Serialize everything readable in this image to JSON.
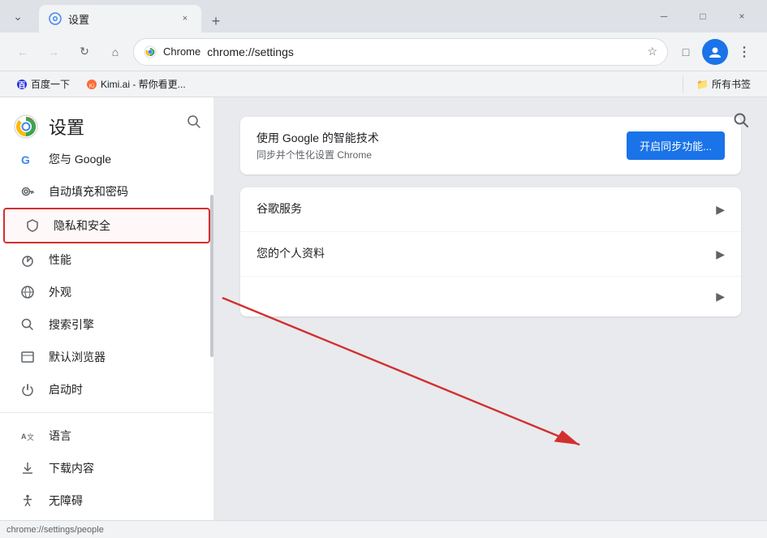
{
  "browser": {
    "tab": {
      "favicon": "⚙",
      "title": "设置",
      "close_label": "×"
    },
    "new_tab_label": "+",
    "window_controls": {
      "minimize": "─",
      "maximize": "□",
      "close": "×"
    },
    "toolbar": {
      "back_label": "←",
      "forward_label": "→",
      "reload_label": "↻",
      "home_label": "⌂",
      "address": "chrome://settings",
      "chrome_label": "Chrome",
      "bookmark_label": "☆",
      "extensions_label": "□",
      "profile_label": "👤",
      "menu_label": "⋮"
    },
    "bookmarks": {
      "item1": "百度一下",
      "item2": "Kimi.ai - 帮你看更...",
      "all_bookmarks": "所有书签"
    },
    "status_bar": {
      "text": "chrome://settings/people"
    }
  },
  "settings": {
    "title": "设置",
    "search_icon": "🔍",
    "sidebar": {
      "items": [
        {
          "id": "google",
          "icon": "G",
          "label": "您与 Google",
          "icon_type": "google"
        },
        {
          "id": "autofill",
          "icon": "🔑",
          "label": "自动填充和密码",
          "icon_type": "key"
        },
        {
          "id": "privacy",
          "icon": "🛡",
          "label": "隐私和安全",
          "icon_type": "shield",
          "highlighted": true
        },
        {
          "id": "performance",
          "icon": "⚡",
          "label": "性能",
          "icon_type": "performance"
        },
        {
          "id": "appearance",
          "icon": "🌐",
          "label": "外观",
          "icon_type": "globe"
        },
        {
          "id": "search",
          "icon": "🔍",
          "label": "搜索引擎",
          "icon_type": "search"
        },
        {
          "id": "browser",
          "icon": "□",
          "label": "默认浏览器",
          "icon_type": "browser"
        },
        {
          "id": "startup",
          "icon": "⏻",
          "label": "启动时",
          "icon_type": "power"
        },
        {
          "id": "language",
          "icon": "A文",
          "label": "语言",
          "icon_type": "language"
        },
        {
          "id": "download",
          "icon": "↓",
          "label": "下载内容",
          "icon_type": "download"
        },
        {
          "id": "accessibility",
          "icon": "♿",
          "label": "无障碍",
          "icon_type": "accessibility"
        }
      ]
    },
    "content": {
      "card1": {
        "title": "使用 Google 的智能技术",
        "subtitle": "同步并个性化设置 Chrome",
        "action_label": "开启同步功能..."
      },
      "card2": {
        "rows": [
          {
            "label": "谷歌服务",
            "has_arrow": true
          },
          {
            "label": "您的个人资料",
            "has_arrow": true
          },
          {
            "label": "",
            "has_arrow": true
          }
        ]
      }
    }
  }
}
